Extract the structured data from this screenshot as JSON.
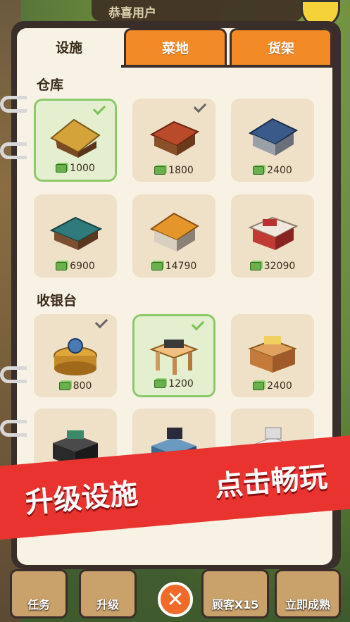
{
  "header": {
    "banner_text": "恭喜用户"
  },
  "tabs": [
    {
      "label": "设施",
      "active": true
    },
    {
      "label": "菜地",
      "active": false
    },
    {
      "label": "货架",
      "active": false
    }
  ],
  "sections": [
    {
      "title": "仓库",
      "items": [
        {
          "price": "1000",
          "selected": true,
          "owned": true,
          "icon": "thatched-hut"
        },
        {
          "price": "1800",
          "selected": false,
          "owned": true,
          "icon": "wooden-house"
        },
        {
          "price": "2400",
          "selected": false,
          "owned": false,
          "icon": "stone-house"
        },
        {
          "price": "6900",
          "selected": false,
          "owned": false,
          "icon": "green-roof-house"
        },
        {
          "price": "14790",
          "selected": false,
          "owned": false,
          "icon": "orange-roof-house"
        },
        {
          "price": "32090",
          "selected": false,
          "owned": false,
          "icon": "modern-store"
        }
      ]
    },
    {
      "title": "收银台",
      "items": [
        {
          "price": "800",
          "selected": false,
          "owned": true,
          "icon": "stump-scale"
        },
        {
          "price": "1200",
          "selected": true,
          "owned": true,
          "icon": "table-scale"
        },
        {
          "price": "2400",
          "selected": false,
          "owned": false,
          "icon": "cabinet-scale"
        },
        {
          "price": "",
          "icon": "black-register"
        },
        {
          "price": "",
          "icon": "laptop-register"
        },
        {
          "price": "",
          "icon": "white-register"
        }
      ]
    }
  ],
  "promo": {
    "left": "升级设施",
    "right": "点击畅玩"
  },
  "bottom_bar": [
    {
      "label": "任务",
      "icon": "task-icon"
    },
    {
      "label": "升级",
      "icon": "hammer-icon"
    },
    {
      "label": "顾客X15",
      "icon": "megaphone-icon"
    },
    {
      "label": "立即成熟",
      "icon": "plant-icon"
    }
  ],
  "close_label": "✕",
  "colors": {
    "accent": "#f28a26",
    "selected": "#8dc86a",
    "ribbon": "#e8332e",
    "cash": "#6ab04c"
  }
}
